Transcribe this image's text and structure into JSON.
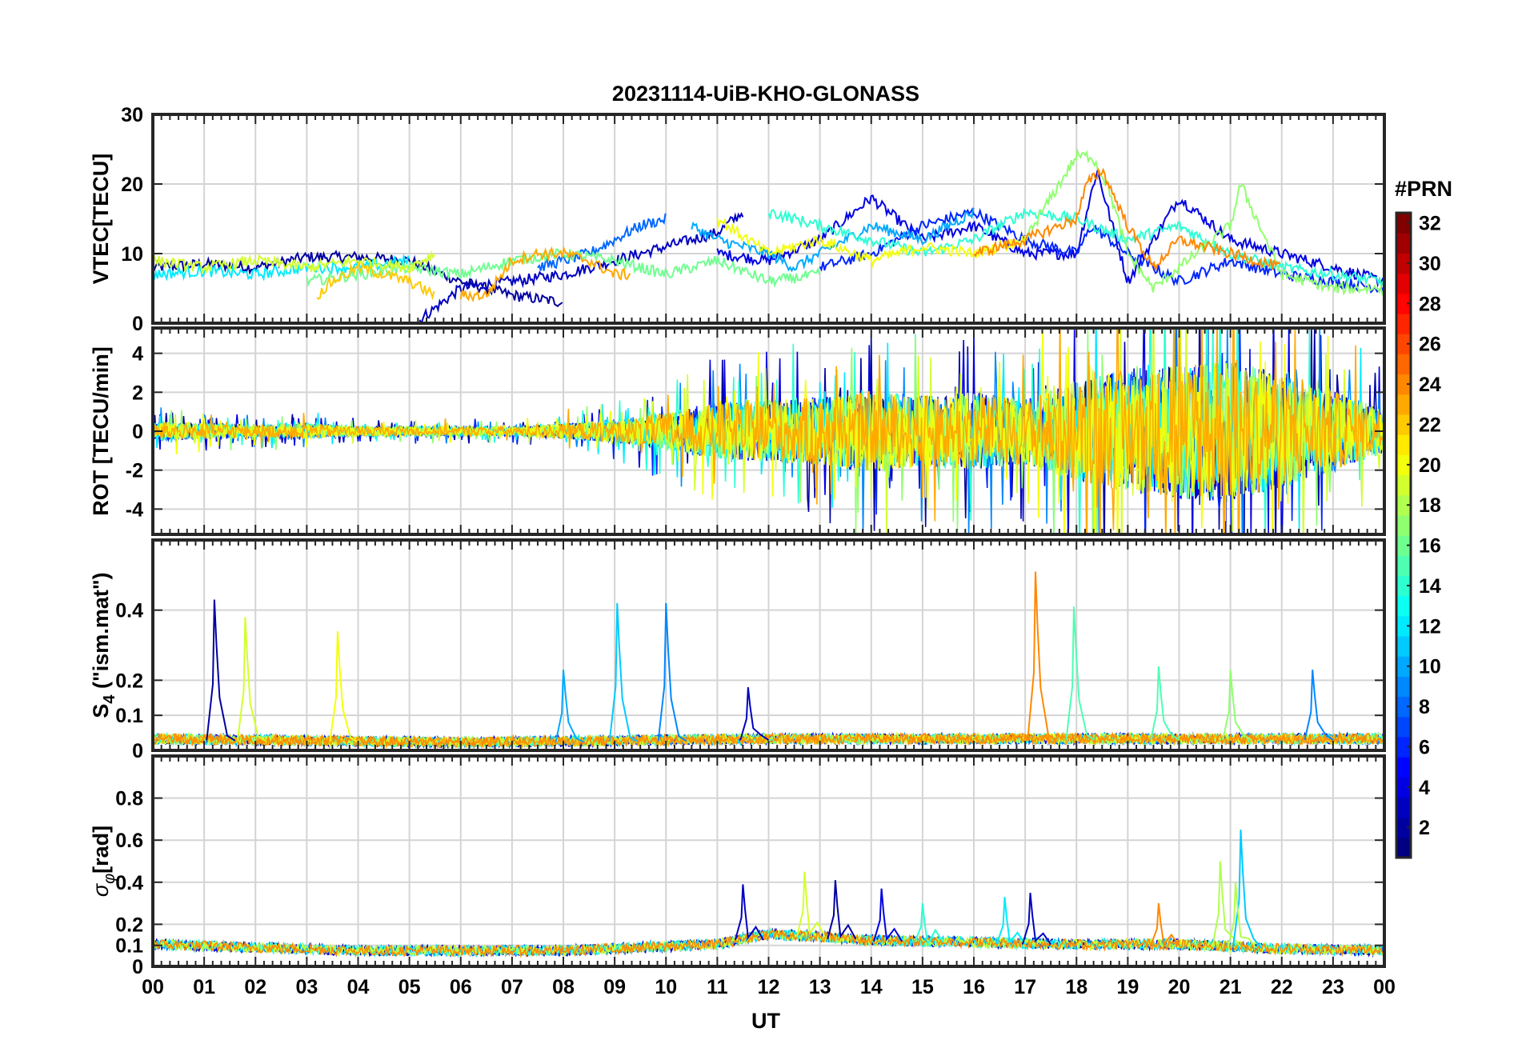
{
  "figure": {
    "title": "20231114-UiB-KHO-GLONASS",
    "xlabel": "UT",
    "x_ticks": [
      "00",
      "01",
      "02",
      "03",
      "04",
      "05",
      "06",
      "07",
      "08",
      "09",
      "10",
      "11",
      "12",
      "13",
      "14",
      "15",
      "16",
      "17",
      "18",
      "19",
      "20",
      "21",
      "22",
      "23",
      "00"
    ]
  },
  "colorbar": {
    "title": "#PRN",
    "colormap": "jet",
    "range": [
      1,
      32
    ],
    "ticks": [
      "2",
      "4",
      "6",
      "8",
      "10",
      "12",
      "14",
      "16",
      "18",
      "20",
      "22",
      "24",
      "26",
      "28",
      "30",
      "32"
    ]
  },
  "chart_data": [
    {
      "type": "line",
      "panel": "VTEC",
      "ylabel": "VTEC[TECU]",
      "ylim": [
        0,
        30
      ],
      "y_ticks": [
        "0",
        "10",
        "20",
        "30"
      ],
      "x_unit": "UT hours",
      "x_range": [
        0,
        24
      ],
      "grid": true,
      "series": [
        {
          "prn": 2,
          "x": [
            0,
            1,
            2,
            3,
            4,
            5,
            6,
            7,
            8
          ],
          "y": [
            8,
            8.5,
            8,
            9.5,
            9.5,
            9,
            6,
            4,
            3
          ]
        },
        {
          "prn": 3,
          "x": [
            5.2,
            6,
            7,
            8,
            9,
            10,
            11,
            11.5
          ],
          "y": [
            0.5,
            5,
            6,
            7,
            9,
            11,
            13,
            16
          ]
        },
        {
          "prn": 4,
          "x": [
            11,
            12,
            13,
            14,
            15,
            16,
            17,
            18,
            18.4,
            19,
            20,
            21,
            22,
            23,
            24
          ],
          "y": [
            10,
            9,
            12,
            18,
            12,
            14,
            10,
            10,
            22,
            6,
            18,
            12,
            10,
            8,
            6
          ]
        },
        {
          "prn": 6,
          "x": [
            13,
            14,
            15,
            16,
            17,
            18,
            18.3,
            19,
            20,
            21,
            22,
            23,
            24
          ],
          "y": [
            8,
            10,
            14,
            16,
            12,
            10,
            14,
            10,
            6,
            9,
            7,
            6,
            5
          ]
        },
        {
          "prn": 8,
          "x": [
            7.5,
            8,
            8.5,
            9,
            9.5,
            10
          ],
          "y": [
            8,
            9,
            10,
            12,
            14,
            15
          ]
        },
        {
          "prn": 10,
          "x": [
            10.5,
            11,
            12,
            12.5,
            13,
            14,
            15,
            16
          ],
          "y": [
            14,
            12,
            10,
            8,
            10,
            14,
            12,
            16
          ]
        },
        {
          "prn": 12,
          "x": [
            0,
            1,
            2,
            3,
            4,
            5
          ],
          "y": [
            7,
            7.5,
            7,
            8,
            8,
            9
          ]
        },
        {
          "prn": 14,
          "x": [
            12,
            13,
            14,
            15,
            16,
            17,
            18,
            19,
            20,
            21,
            22,
            23,
            24
          ],
          "y": [
            16,
            14,
            12,
            10,
            12,
            16,
            15,
            12,
            14,
            10,
            8,
            7,
            6
          ]
        },
        {
          "prn": 16,
          "x": [
            3,
            4,
            5,
            6,
            7,
            8,
            9,
            10,
            11,
            12,
            13
          ],
          "y": [
            6,
            7,
            8,
            7,
            9,
            10,
            9,
            7,
            9,
            6,
            7
          ]
        },
        {
          "prn": 17,
          "x": [
            17,
            17.5,
            18,
            18.3,
            18.6,
            19,
            19.5,
            20,
            21,
            21.2,
            22,
            23,
            24
          ],
          "y": [
            12,
            18,
            24,
            24,
            20,
            10,
            5,
            8,
            14,
            20,
            7,
            5,
            5
          ]
        },
        {
          "prn": 19,
          "x": [
            0,
            1,
            2,
            3,
            4,
            5,
            5.5
          ],
          "y": [
            9,
            8,
            9,
            8,
            9,
            8,
            10
          ]
        },
        {
          "prn": 20,
          "x": [
            11,
            12,
            13,
            14,
            15,
            16,
            17
          ],
          "y": [
            15,
            10,
            12,
            9,
            11,
            10,
            12
          ]
        },
        {
          "prn": 22,
          "x": [
            3.2,
            3.5,
            4,
            5,
            5.5
          ],
          "y": [
            4,
            6,
            8,
            6,
            4
          ]
        },
        {
          "prn": 23,
          "x": [
            6,
            6.5,
            7,
            7.5,
            8,
            8.5,
            9,
            9.3
          ],
          "y": [
            4,
            4,
            9,
            10,
            10,
            9,
            7,
            7
          ]
        },
        {
          "prn": 24,
          "x": [
            16,
            17,
            18,
            18.2,
            18.5,
            19,
            19.5,
            20,
            21,
            22
          ],
          "y": [
            10,
            12,
            15,
            20,
            22,
            14,
            8,
            12,
            10,
            8
          ]
        }
      ]
    },
    {
      "type": "line",
      "panel": "ROT",
      "ylabel": "ROT [TECU/min]",
      "ylim": [
        -5.3,
        5.3
      ],
      "y_ticks": [
        "-4",
        "-2",
        "0",
        "2",
        "4"
      ],
      "x_unit": "UT hours",
      "x_range": [
        0,
        24
      ],
      "grid": true,
      "envelope": {
        "x": [
          0,
          1,
          2,
          3,
          4,
          5,
          6,
          7,
          8,
          9,
          10,
          11,
          12,
          13,
          14,
          15,
          16,
          17,
          18,
          19,
          20,
          21,
          22,
          23,
          24
        ],
        "amplitude": [
          0.6,
          0.5,
          0.4,
          0.5,
          0.3,
          0.3,
          0.3,
          0.3,
          0.5,
          0.7,
          1.2,
          1.8,
          2.0,
          2.2,
          2.6,
          2.3,
          2.5,
          2.1,
          3.2,
          4.0,
          4.3,
          4.6,
          3.6,
          2.6,
          1.4
        ]
      },
      "prns": [
        2,
        4,
        6,
        9,
        12,
        14,
        17,
        19,
        20,
        23
      ]
    },
    {
      "type": "line",
      "panel": "S4",
      "ylabel_main": "S",
      "ylabel_sub": "4",
      "ylabel_tail": "  (\"ism.mat\")",
      "ylim": [
        0,
        0.6
      ],
      "y_ticks": [
        "0",
        "0.1",
        "0.2",
        "0.4"
      ],
      "x_unit": "UT hours",
      "x_range": [
        0,
        24
      ],
      "grid": true,
      "baseline": {
        "x": [
          0,
          6,
          12,
          18,
          24
        ],
        "level": [
          0.03,
          0.02,
          0.03,
          0.03,
          0.03
        ],
        "noise": 0.03
      },
      "spikes": [
        {
          "x": 1.2,
          "y": 0.43,
          "prn": 2
        },
        {
          "x": 1.8,
          "y": 0.38,
          "prn": 19
        },
        {
          "x": 3.6,
          "y": 0.34,
          "prn": 20
        },
        {
          "x": 9.05,
          "y": 0.42,
          "prn": 11
        },
        {
          "x": 10.0,
          "y": 0.42,
          "prn": 9
        },
        {
          "x": 17.2,
          "y": 0.51,
          "prn": 24
        },
        {
          "x": 17.95,
          "y": 0.41,
          "prn": 15
        },
        {
          "x": 19.6,
          "y": 0.24,
          "prn": 15
        },
        {
          "x": 21.0,
          "y": 0.23,
          "prn": 17
        },
        {
          "x": 22.6,
          "y": 0.23,
          "prn": 9
        },
        {
          "x": 8.0,
          "y": 0.23,
          "prn": 10
        },
        {
          "x": 11.6,
          "y": 0.18,
          "prn": 3
        }
      ],
      "prns": [
        2,
        5,
        9,
        12,
        15,
        17,
        19,
        23,
        24
      ]
    },
    {
      "type": "line",
      "panel": "SigmaPhi",
      "ylabel_main": "σ",
      "ylabel_sub": "φ",
      "ylabel_tail": "[rad]",
      "ylim": [
        0,
        1.0
      ],
      "y_ticks": [
        "0",
        "0.1",
        "0.2",
        "0.4",
        "0.6",
        "0.8"
      ],
      "x_unit": "UT hours",
      "x_range": [
        0,
        24
      ],
      "grid": true,
      "baseline": {
        "x": [
          0,
          4,
          8,
          11,
          12,
          14,
          18,
          20,
          22,
          24
        ],
        "level": [
          0.1,
          0.07,
          0.07,
          0.1,
          0.15,
          0.12,
          0.1,
          0.1,
          0.08,
          0.07
        ],
        "noise": 0.05
      },
      "spikes": [
        {
          "x": 11.5,
          "y": 0.39,
          "prn": 3
        },
        {
          "x": 12.7,
          "y": 0.45,
          "prn": 19
        },
        {
          "x": 13.3,
          "y": 0.41,
          "prn": 2
        },
        {
          "x": 14.2,
          "y": 0.37,
          "prn": 4
        },
        {
          "x": 15.0,
          "y": 0.3,
          "prn": 14
        },
        {
          "x": 16.6,
          "y": 0.33,
          "prn": 12
        },
        {
          "x": 17.1,
          "y": 0.35,
          "prn": 3
        },
        {
          "x": 19.6,
          "y": 0.3,
          "prn": 24
        },
        {
          "x": 20.8,
          "y": 0.5,
          "prn": 18
        },
        {
          "x": 21.2,
          "y": 0.65,
          "prn": 11
        },
        {
          "x": 21.1,
          "y": 0.4,
          "prn": 18
        }
      ],
      "prns": [
        2,
        4,
        9,
        12,
        15,
        19,
        24
      ]
    }
  ]
}
